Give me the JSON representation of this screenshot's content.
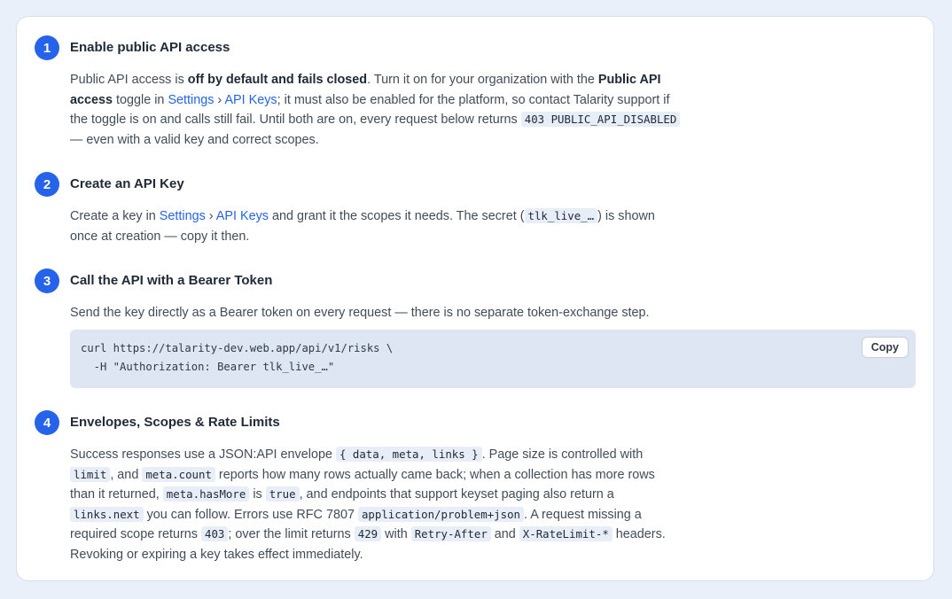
{
  "steps": [
    {
      "number": "1",
      "title": "Enable public API access",
      "body": {
        "t1": "Public API access is ",
        "b1": "off by default and fails closed",
        "t2": ". Turn it on for your organization with the ",
        "b2": "Public API access",
        "t3": " toggle in ",
        "link1": "Settings",
        "sep": " › ",
        "link2": "API Keys",
        "t4": "; it must also be enabled for the platform, so contact Talarity support if the toggle is on and calls still fail. Until both are on, every request below returns ",
        "code1": "403 PUBLIC_API_DISABLED",
        "t5": " — even with a valid key and correct scopes."
      }
    },
    {
      "number": "2",
      "title": "Create an API Key",
      "body": {
        "t1": "Create a key in ",
        "link1": "Settings",
        "sep": " › ",
        "link2": "API Keys",
        "t2": " and grant it the scopes it needs. The secret (",
        "code1": "tlk_live_…",
        "t3": ") is shown once at creation — copy it then."
      }
    },
    {
      "number": "3",
      "title": "Call the API with a Bearer Token",
      "body": {
        "t1": "Send the key directly as a Bearer token on every request — there is no separate token-exchange step."
      },
      "code": {
        "line1": "curl https://talarity-dev.web.app/api/v1/risks \\",
        "line2": "  -H \"Authorization: Bearer tlk_live_…\"",
        "copy_label": "Copy"
      }
    },
    {
      "number": "4",
      "title": "Envelopes, Scopes & Rate Limits",
      "body": {
        "t1": "Success responses use a JSON:API envelope ",
        "c1": "{ data, meta, links }",
        "t2": ". Page size is controlled with ",
        "c2": "limit",
        "t3": ", and ",
        "c3": "meta.count",
        "t4": " reports how many rows actually came back; when a collection has more rows than it returned, ",
        "c4": "meta.hasMore",
        "t5": " is ",
        "c5": "true",
        "t6": ", and endpoints that support keyset paging also return a ",
        "c6": "links.next",
        "t7": " you can follow. Errors use RFC 7807 ",
        "c7": "application/problem+json",
        "t8": ". A request missing a required scope returns ",
        "c8": "403",
        "t9": "; over the limit returns ",
        "c9": "429",
        "t10": " with ",
        "c10": "Retry-After",
        "t11": " and ",
        "c11": "X-RateLimit-*",
        "t12": " headers. Revoking or expiring a key takes effect immediately."
      }
    }
  ],
  "colors": {
    "accent": "#2563eb",
    "background": "#e9f0f9",
    "code_bg": "#dde6f2"
  }
}
